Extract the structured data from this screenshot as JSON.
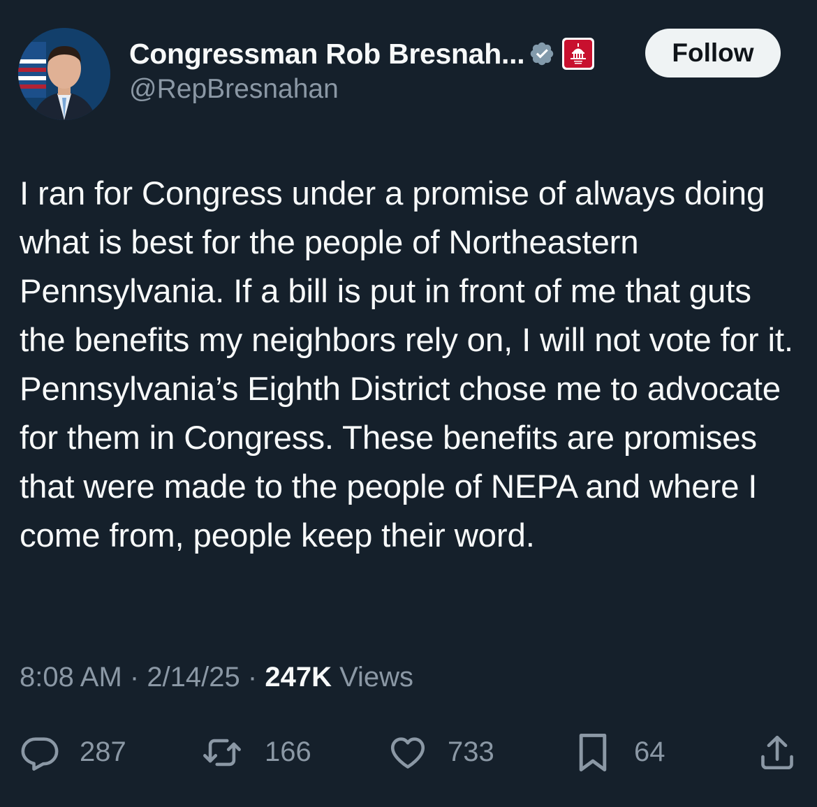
{
  "account": {
    "display_name": "Congressman Rob Bresnah...",
    "handle": "@RepBresnahan",
    "verified_icon": "verified-badge-icon",
    "affiliation_icon": "house-gop-affiliation-icon",
    "affiliation_badge_color": "#c8102e"
  },
  "follow_label": "Follow",
  "tweet": {
    "text": "I ran for Congress under a promise of always doing what is best for the people of Northeastern Pennsylvania. If a bill is put in front of me that guts the benefits my neighbors rely on, I will not vote for it. Pennsylvania’s Eighth District chose me to advocate for them in Congress. These benefits are promises that were made to the people of NEPA and where I come from, people keep their word."
  },
  "meta": {
    "time": "8:08 AM",
    "sep1": " · ",
    "date": "2/14/25",
    "sep2": " · ",
    "views_count": "247K",
    "views_label": " Views"
  },
  "actions": {
    "replies": "287",
    "reposts": "166",
    "likes": "733",
    "bookmarks": "64"
  },
  "colors": {
    "background": "#15202b",
    "primary_text": "#f7f9f9",
    "secondary_text": "#8b98a5",
    "verified": "#829aab",
    "follow_button_bg": "#eff3f4"
  }
}
